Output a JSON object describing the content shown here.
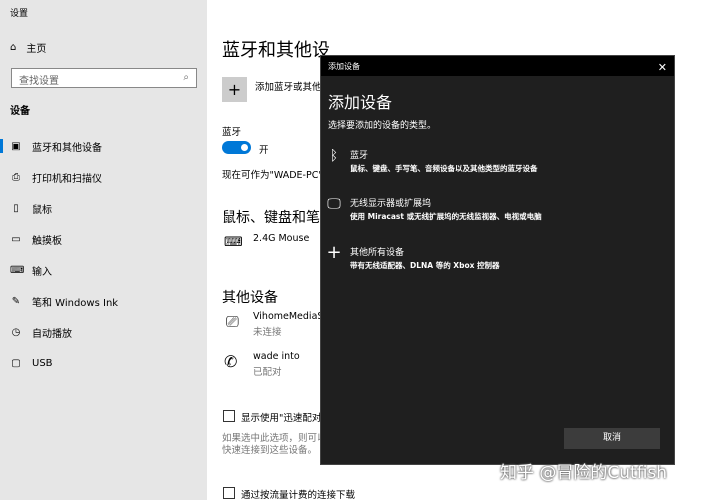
{
  "sidebar": {
    "app_title": "设置",
    "home": "主页",
    "search_placeholder": "查找设置",
    "section": "设备",
    "items": [
      {
        "label": "蓝牙和其他设备",
        "icon": "bluetooth-devices-icon"
      },
      {
        "label": "打印机和扫描仪",
        "icon": "printer-icon"
      },
      {
        "label": "鼠标",
        "icon": "mouse-icon"
      },
      {
        "label": "触摸板",
        "icon": "touchpad-icon"
      },
      {
        "label": "输入",
        "icon": "keyboard-icon"
      },
      {
        "label": "笔和 Windows Ink",
        "icon": "pen-icon"
      },
      {
        "label": "自动播放",
        "icon": "autoplay-icon"
      },
      {
        "label": "USB",
        "icon": "usb-icon"
      }
    ]
  },
  "main": {
    "title": "蓝牙和其他设",
    "add_label": "添加蓝牙或其他",
    "bt_label": "蓝牙",
    "bt_state": "开",
    "discoverable": "现在可作为\"WADE-PC\"被",
    "mouse_section": "鼠标、键盘和笔",
    "mouse_device": "2.4G Mouse",
    "other_section": "其他设备",
    "other_devices": [
      {
        "name": "VihomeMediaSe",
        "status": "未连接"
      },
      {
        "name": "wade into",
        "status": "已配对"
      }
    ],
    "swift_pair": "显示使用\"迅速配对\"",
    "swift_desc1": "如果选中此选项，则可以",
    "swift_desc2": "快速连接到这些设备。",
    "metered": "通过按流量计费的连接下载"
  },
  "dialog": {
    "window_title": "添加设备",
    "heading": "添加设备",
    "subtitle": "选择要添加的设备的类型。",
    "options": [
      {
        "title": "蓝牙",
        "desc": "鼠标、键盘、手写笔、音频设备以及其他类型的蓝牙设备"
      },
      {
        "title": "无线显示器或扩展坞",
        "desc": "使用 Miracast 或无线扩展坞的无线监视器、电视或电脑"
      },
      {
        "title": "其他所有设备",
        "desc": "带有无线适配器、DLNA 等的 Xbox 控制器"
      }
    ],
    "cancel": "取消"
  },
  "watermark": "知乎 @冒险的Cutfish",
  "colors": {
    "accent": "#0078d7",
    "dialog_bg": "#1f1f1f",
    "sidebar_bg": "#e6e6e6"
  }
}
